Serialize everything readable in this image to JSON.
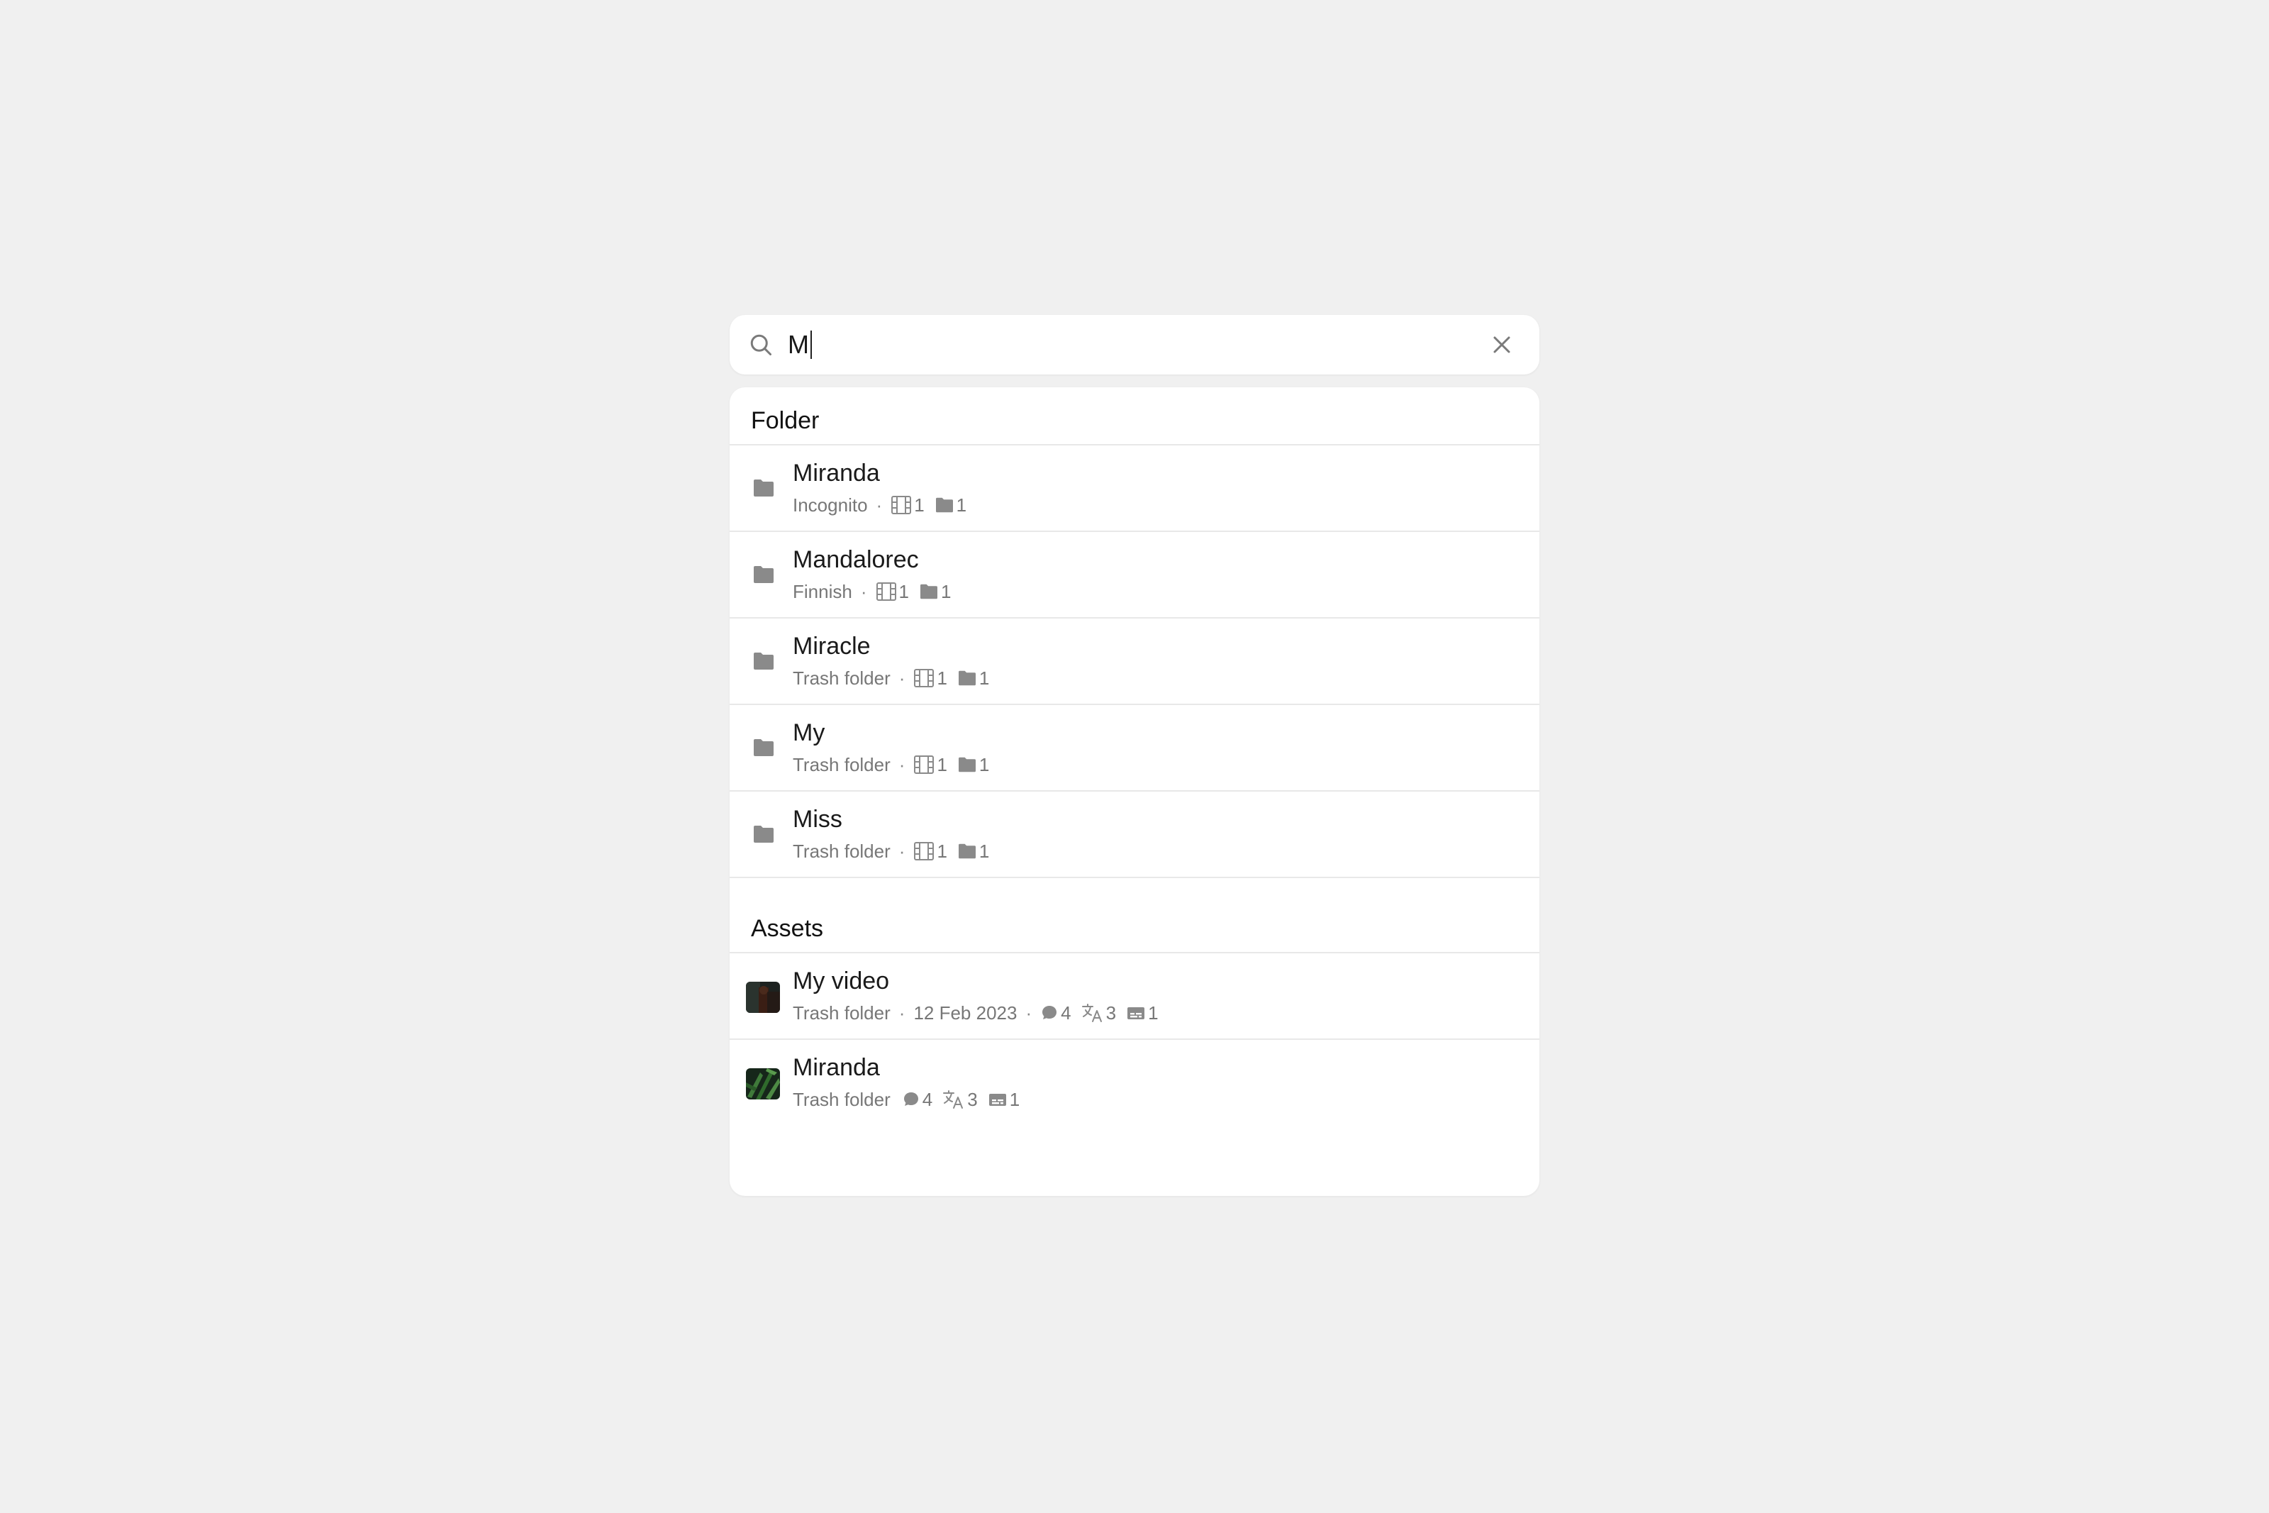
{
  "search": {
    "query": "M"
  },
  "folder_section": {
    "title": "Folder",
    "items": [
      {
        "name": "Miranda",
        "location": "Incognito",
        "videos": "1",
        "folders": "1"
      },
      {
        "name": "Mandalorec",
        "location": "Finnish",
        "videos": "1",
        "folders": "1"
      },
      {
        "name": "Miracle",
        "location": "Trash folder",
        "videos": "1",
        "folders": "1"
      },
      {
        "name": "My",
        "location": "Trash folder",
        "videos": "1",
        "folders": "1"
      },
      {
        "name": "Miss",
        "location": "Trash folder",
        "videos": "1",
        "folders": "1"
      }
    ]
  },
  "assets_section": {
    "title": "Assets",
    "items": [
      {
        "name": "My video",
        "location": "Trash folder",
        "date": "12 Feb 2023",
        "comments": "4",
        "translations": "3",
        "subtitles": "1"
      },
      {
        "name": "Miranda",
        "location": "Trash folder",
        "comments": "4",
        "translations": "3",
        "subtitles": "1"
      }
    ]
  },
  "colors": {
    "background": "#f0f0f0",
    "panel": "#ffffff",
    "icon_gray": "#8a8a8a",
    "meta_text": "#777777"
  }
}
